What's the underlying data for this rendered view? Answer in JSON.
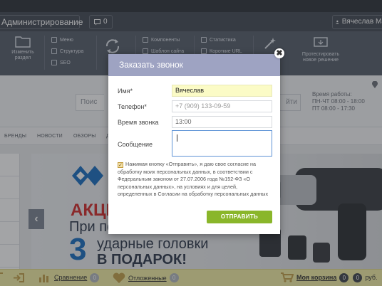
{
  "admin": {
    "title": "Администрирование",
    "notifications": "0",
    "user": "Вячеслав Мас",
    "toolbar": {
      "change_section": "Изменить раздел",
      "menu": "Меню",
      "structure": "Структура",
      "seo": "SEO",
      "components": "Компоненты",
      "site_template": "Шаблон сайта",
      "statistics": "Статистика",
      "short_urls": "Короткие URL",
      "test_solution": "Протестировать новое решение"
    }
  },
  "site": {
    "search_placeholder": "Поис",
    "search_button": "йти",
    "hours": [
      "Время работы:",
      "ПН-ЧТ 08:00 - 18:00",
      "ПТ 08:00 - 17:30"
    ],
    "nav": [
      "БРЕНДЫ",
      "НОВОСТИ",
      "ОБЗОРЫ",
      "Д"
    ],
    "banner": {
      "line1": "АКЦИ",
      "line2": "При по",
      "number": "3",
      "line3": "ударные головки",
      "line4": "В ПОДАРОК!"
    }
  },
  "bottombar": {
    "compare_label": "Сравнение",
    "compare_count": "0",
    "deferred_label": "Отложенные",
    "deferred_count": "0",
    "cart_label": "Моя корзина",
    "cart_count": "0",
    "cart_sum": "0",
    "currency": "руб."
  },
  "modal": {
    "title": "Заказать звонок",
    "name_label": "Имя*",
    "name_value": "Вячеслав",
    "phone_label": "Телефон*",
    "phone_placeholder": "+7 (909) 133-09-59",
    "time_label": "Время звонка",
    "time_value": "13:00",
    "message_label": "Сообщение",
    "consent_text": "Нажимая кнопку «Отправить», я даю свое согласие на обработку моих персональных данных, в соответствии с Федеральным законом от 27.07.2006 года №152-ФЗ «О персональных данных», на условиях и для целей, определенных в Согласии на обработку персональных данных",
    "submit": "ОТПРАВИТЬ"
  }
}
